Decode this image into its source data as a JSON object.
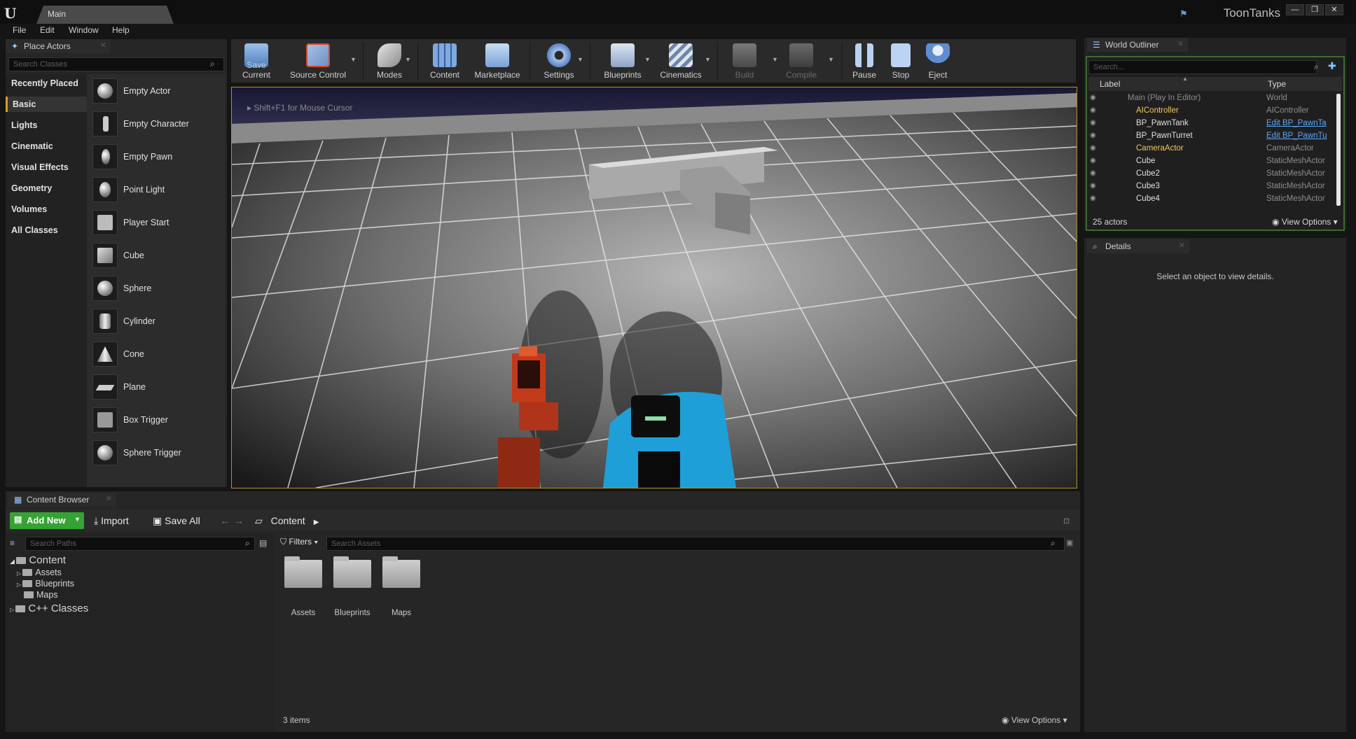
{
  "window": {
    "doc_tab": "Main",
    "project": "ToonTanks",
    "min": "—",
    "max": "❐",
    "close": "✕"
  },
  "menu": [
    "File",
    "Edit",
    "Window",
    "Help"
  ],
  "place_actors": {
    "tab": "Place Actors",
    "search_placeholder": "Search Classes",
    "categories": [
      "Recently Placed",
      "Basic",
      "Lights",
      "Cinematic",
      "Visual Effects",
      "Geometry",
      "Volumes",
      "All Classes"
    ],
    "selected_category": "Basic",
    "actors": [
      "Empty Actor",
      "Empty Character",
      "Empty Pawn",
      "Point Light",
      "Player Start",
      "Cube",
      "Sphere",
      "Cylinder",
      "Cone",
      "Plane",
      "Box Trigger",
      "Sphere Trigger"
    ]
  },
  "toolbar": {
    "buttons": [
      "Save Current",
      "Source Control",
      "Modes",
      "Content",
      "Marketplace",
      "Settings",
      "Blueprints",
      "Cinematics",
      "Build",
      "Compile",
      "Pause",
      "Stop",
      "Eject"
    ]
  },
  "viewport": {
    "hint": "Shift+F1 for Mouse Cursor"
  },
  "world_outliner": {
    "tab": "World Outliner",
    "search_placeholder": "Search...",
    "col_label": "Label",
    "col_type": "Type",
    "rows": [
      {
        "label": "Main (Play In Editor)",
        "type": "World"
      },
      {
        "label": "AIController",
        "type": "AIController"
      },
      {
        "label": "BP_PawnTank",
        "type": "Edit BP_PawnTa"
      },
      {
        "label": "BP_PawnTurret",
        "type": "Edit BP_PawnTu"
      },
      {
        "label": "CameraActor",
        "type": "CameraActor"
      },
      {
        "label": "Cube",
        "type": "StaticMeshActor"
      },
      {
        "label": "Cube2",
        "type": "StaticMeshActor"
      },
      {
        "label": "Cube3",
        "type": "StaticMeshActor"
      },
      {
        "label": "Cube4",
        "type": "StaticMeshActor"
      }
    ],
    "actor_count": "25 actors",
    "view_options": "View Options"
  },
  "details": {
    "tab": "Details",
    "message": "Select an object to view details."
  },
  "content_browser": {
    "tab": "Content Browser",
    "add_new": "Add New",
    "import": "Import",
    "save_all": "Save All",
    "breadcrumb": "Content",
    "search_paths_placeholder": "Search Paths",
    "filters": "Filters",
    "search_assets_placeholder": "Search Assets",
    "tree": {
      "root": "Content",
      "children": [
        "Assets",
        "Blueprints",
        "Maps"
      ],
      "cpp": "C++ Classes"
    },
    "assets": [
      "Assets",
      "Blueprints",
      "Maps"
    ],
    "items_count": "3 items",
    "view_options": "View Options"
  },
  "colors": {
    "accent": "#e09a20",
    "add_new": "#35a334",
    "link": "#5aa8ff",
    "outliner_focus": "#3f6a31"
  }
}
